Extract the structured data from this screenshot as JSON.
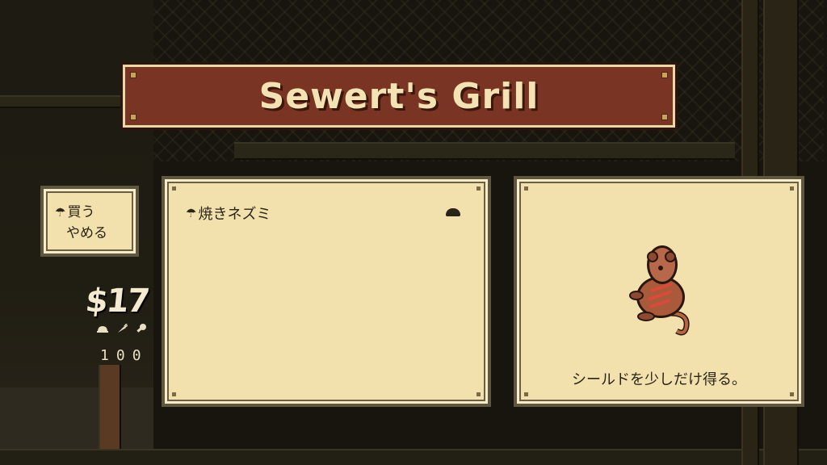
{
  "shop": {
    "title": "Sewert's Grill"
  },
  "menu": {
    "cursor_icon": "umbrella-cursor-icon",
    "items": [
      {
        "label": "買う",
        "selected": true
      },
      {
        "label": "やめる",
        "selected": false
      }
    ]
  },
  "player": {
    "money": "$17",
    "stat_icons": [
      "food-icon",
      "carrot-icon",
      "drumstick-icon"
    ],
    "stat_values": [
      "1",
      "0",
      "0"
    ]
  },
  "item_list": [
    {
      "name": "焼きネズミ",
      "category_icon": "food-icon",
      "selected": true
    }
  ],
  "detail": {
    "sprite": "roasted-rat-sprite",
    "description": "シールドを少しだけ得る。"
  },
  "colors": {
    "banner": "#7a3423",
    "panel": "#f2e1ac",
    "text": "#2a2418"
  }
}
